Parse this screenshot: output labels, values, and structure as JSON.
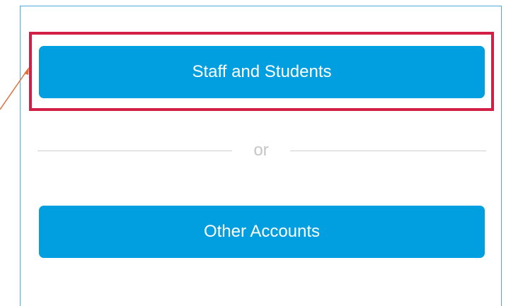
{
  "login": {
    "primary_button_label": "Staff and Students",
    "separator_text": "or",
    "secondary_button_label": "Other Accounts"
  },
  "annotation": {
    "highlight_color": "#d11f45",
    "arrow_color": "#e0703a"
  },
  "colors": {
    "button": "#029fe0",
    "panel_border": "#4fa9dc"
  }
}
